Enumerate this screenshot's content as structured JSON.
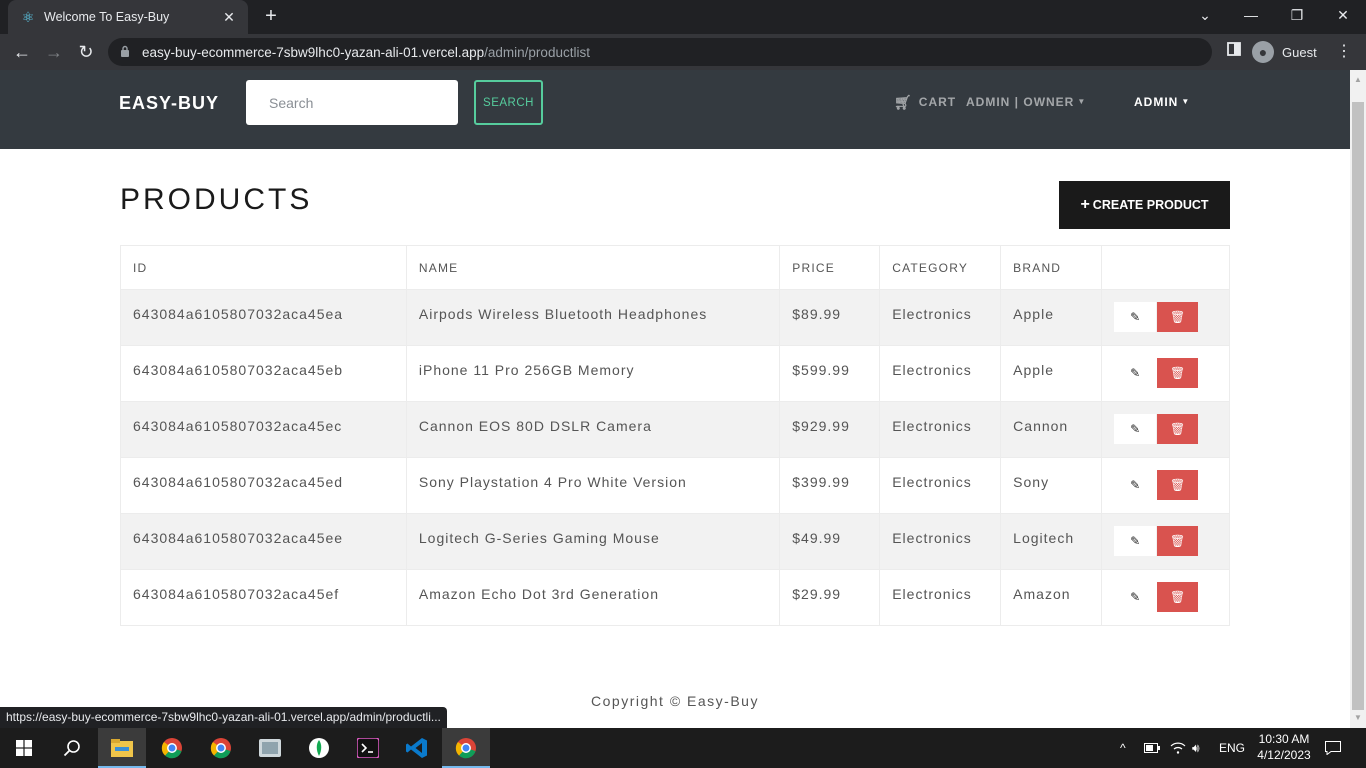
{
  "browser": {
    "tab_title": "Welcome To Easy-Buy",
    "new_tab": "+",
    "url_host": "easy-buy-ecommerce-7sbw9lhc0-yazan-ali-01.vercel.app",
    "url_path": "/admin/productlist",
    "profile_name": "Guest",
    "status_url": "https://easy-buy-ecommerce-7sbw9lhc0-yazan-ali-01.vercel.app/admin/productli..."
  },
  "navbar": {
    "brand": "EASY-BUY",
    "search_placeholder": "Search",
    "search_button": "SEARCH",
    "cart": "CART",
    "user_menu": "ADMIN | OWNER",
    "admin_menu": "ADMIN"
  },
  "page": {
    "title": "PRODUCTS",
    "create_button": "CREATE PRODUCT"
  },
  "table": {
    "headers": [
      "ID",
      "NAME",
      "PRICE",
      "CATEGORY",
      "BRAND"
    ],
    "rows": [
      {
        "id": "643084a6105807032aca45ea",
        "name": "Airpods Wireless Bluetooth Headphones",
        "price": "$89.99",
        "category": "Electronics",
        "brand": "Apple"
      },
      {
        "id": "643084a6105807032aca45eb",
        "name": "iPhone 11 Pro 256GB Memory",
        "price": "$599.99",
        "category": "Electronics",
        "brand": "Apple"
      },
      {
        "id": "643084a6105807032aca45ec",
        "name": "Cannon EOS 80D DSLR Camera",
        "price": "$929.99",
        "category": "Electronics",
        "brand": "Cannon"
      },
      {
        "id": "643084a6105807032aca45ed",
        "name": "Sony Playstation 4 Pro White Version",
        "price": "$399.99",
        "category": "Electronics",
        "brand": "Sony"
      },
      {
        "id": "643084a6105807032aca45ee",
        "name": "Logitech G-Series Gaming Mouse",
        "price": "$49.99",
        "category": "Electronics",
        "brand": "Logitech"
      },
      {
        "id": "643084a6105807032aca45ef",
        "name": "Amazon Echo Dot 3rd Generation",
        "price": "$29.99",
        "category": "Electronics",
        "brand": "Amazon"
      }
    ]
  },
  "footer": {
    "copyright": "Copyright © Easy-Buy"
  },
  "taskbar": {
    "language": "ENG",
    "time": "10:30 AM",
    "date": "4/12/2023"
  },
  "icons": {
    "edit": "edit-icon",
    "delete": "trash-icon",
    "cart": "cart-icon"
  },
  "colors": {
    "navbar_bg": "#343a40",
    "search_accent": "#56cc9d",
    "delete_bg": "#d9534f",
    "create_bg": "#1a1a1a"
  }
}
